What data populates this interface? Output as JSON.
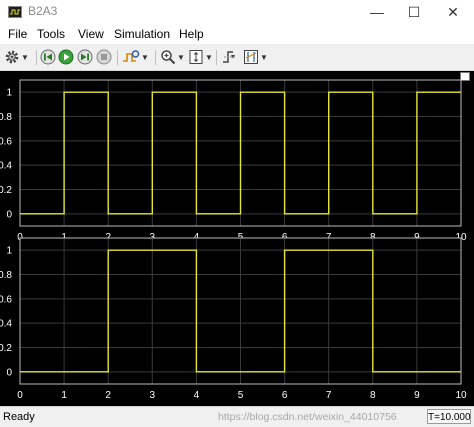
{
  "window": {
    "title": "B2A3",
    "minimize": "—",
    "maximize": "☐",
    "close": "✕"
  },
  "menu": {
    "items": [
      "File",
      "Tools",
      "View",
      "Simulation",
      "Help"
    ]
  },
  "colors": {
    "trace": "#e6e631",
    "background": "#000000",
    "axes": "#ffffff",
    "grid": "#3a3a3a"
  },
  "toolbar_icons": [
    "gear-icon",
    "step-back-icon",
    "run-icon",
    "step-forward-icon",
    "stop-icon",
    "highlight-signal-icon",
    "zoom-icon",
    "autoscale-icon",
    "triggers-icon",
    "cursor-measurements-icon"
  ],
  "chart_data": [
    {
      "type": "line",
      "step": true,
      "xlim": [
        0,
        10
      ],
      "ylim": [
        -0.1,
        1.1
      ],
      "x_ticks": [
        "0",
        "1",
        "2",
        "3",
        "4",
        "5",
        "6",
        "7",
        "8",
        "9",
        "10"
      ],
      "y_ticks": [
        "0",
        "0.2",
        "0.4",
        "0.6",
        "0.8",
        "1"
      ],
      "grid": true,
      "series": [
        {
          "x": [
            0,
            1,
            1,
            2,
            2,
            3,
            3,
            4,
            4,
            5,
            5,
            6,
            6,
            7,
            7,
            8,
            8,
            9,
            9,
            10
          ],
          "y": [
            0,
            0,
            1,
            1,
            0,
            0,
            1,
            1,
            0,
            0,
            1,
            1,
            0,
            0,
            1,
            1,
            0,
            0,
            1,
            1
          ]
        }
      ]
    },
    {
      "type": "line",
      "step": true,
      "xlim": [
        0,
        10
      ],
      "ylim": [
        -0.1,
        1.1
      ],
      "x_ticks": [
        "0",
        "1",
        "2",
        "3",
        "4",
        "5",
        "6",
        "7",
        "8",
        "9",
        "10"
      ],
      "y_ticks": [
        "0",
        "0.2",
        "0.4",
        "0.6",
        "0.8",
        "1"
      ],
      "grid": true,
      "series": [
        {
          "x": [
            0,
            2,
            2,
            4,
            4,
            6,
            6,
            8,
            8,
            10
          ],
          "y": [
            0,
            0,
            1,
            1,
            0,
            0,
            1,
            1,
            0,
            0
          ]
        }
      ]
    }
  ],
  "status": {
    "ready": "Ready",
    "watermark": "https://blog.csdn.net/weixin_44010756",
    "time": "T=10.000"
  }
}
